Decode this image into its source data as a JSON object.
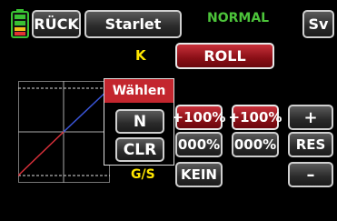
{
  "header": {
    "back_label": "RÜCK",
    "model_name": "Starlet",
    "phase": "NORMAL",
    "save_label": "Sv",
    "phase_color": "#4cc43a"
  },
  "channel": {
    "k_label": "K",
    "function_label": "ROLL"
  },
  "popup": {
    "title": "Wählen",
    "n_label": "N",
    "clr_label": "CLR"
  },
  "values": {
    "left_top": "+100%",
    "right_top": "+100%",
    "left_mid": "000%",
    "right_mid": "000%",
    "gs_label": "G/S",
    "kein_label": "KEIN"
  },
  "controls": {
    "plus_label": "+",
    "res_label": "RES",
    "minus_label": "–"
  },
  "colors": {
    "accent_yellow": "#ffe600",
    "curve_blue": "#3a55d8",
    "curve_red": "#d8303a",
    "battery_green": "#39c233",
    "battery_red": "#e23232"
  }
}
